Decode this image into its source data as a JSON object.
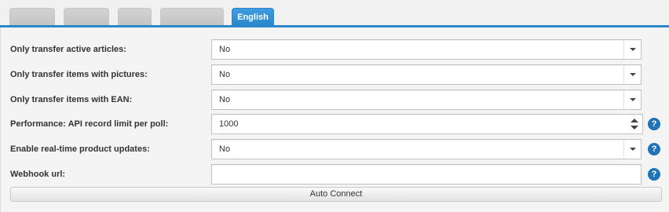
{
  "tabs": [
    {
      "label": ""
    },
    {
      "label": ""
    },
    {
      "label": ""
    },
    {
      "label": ""
    },
    {
      "label": "English",
      "active": true
    }
  ],
  "form": {
    "active_articles": {
      "label": "Only transfer active articles:",
      "value": "No"
    },
    "with_pictures": {
      "label": "Only transfer items with pictures:",
      "value": "No"
    },
    "with_ean": {
      "label": "Only transfer items with EAN:",
      "value": "No"
    },
    "api_limit": {
      "label": "Performance: API record limit per poll:",
      "value": "1000",
      "help_icon": "question-icon"
    },
    "realtime_updates": {
      "label": "Enable real-time product updates:",
      "value": "No",
      "help_icon": "question-icon"
    },
    "webhook_url": {
      "label": "Webhook url:",
      "value": "",
      "help_icon": "question-icon"
    },
    "help_glyph": "?"
  },
  "actions": {
    "auto_connect_label": "Auto Connect"
  },
  "colors": {
    "accent": "#2a87cc",
    "help": "#1f73b7",
    "background": "#f1f1f1"
  }
}
